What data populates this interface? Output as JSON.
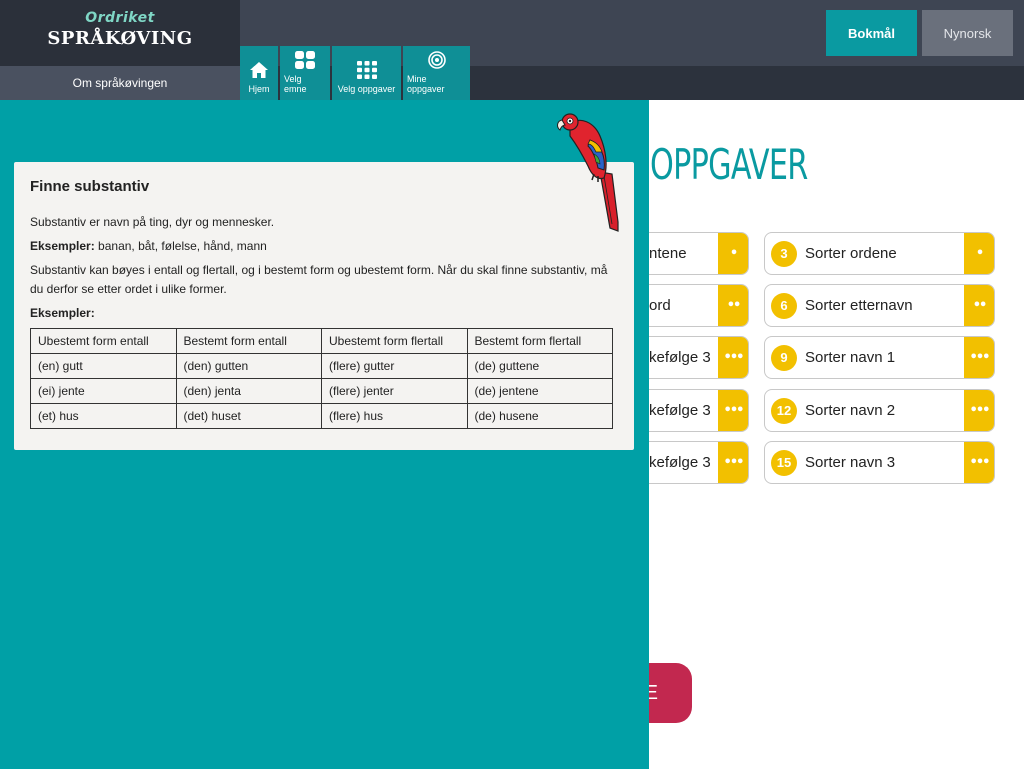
{
  "brand": {
    "logo_top": "Ordriket",
    "logo_main": "SPRÅKØVING"
  },
  "about_link": "Om språkøvingen",
  "nav": [
    {
      "label": "Hjem",
      "icon": "home-icon"
    },
    {
      "label": "Velg emne",
      "icon": "grid-four-icon"
    },
    {
      "label": "Velg oppgaver",
      "icon": "grid-nine-icon"
    },
    {
      "label": "Mine oppgaver",
      "icon": "target-icon"
    }
  ],
  "languages": {
    "bokmal": "Bokmål",
    "nynorsk": "Nynorsk"
  },
  "main": {
    "heading": "OPPGAVER",
    "left_tasks": [
      {
        "label": "ntene",
        "dots": "•"
      },
      {
        "label": "ord",
        "dots": "••"
      },
      {
        "label": "kefølge 3",
        "dots": "•••"
      },
      {
        "label": "kefølge 3",
        "dots": "•••"
      },
      {
        "label": "kefølge 3",
        "dots": "•••"
      }
    ],
    "right_tasks": [
      {
        "num": "3",
        "label": "Sorter ordene",
        "dots": "•"
      },
      {
        "num": "6",
        "label": "Sorter etternavn",
        "dots": "••"
      },
      {
        "num": "9",
        "label": "Sorter navn 1",
        "dots": "•••"
      },
      {
        "num": "12",
        "label": "Sorter navn 2",
        "dots": "•••"
      },
      {
        "num": "15",
        "label": "Sorter navn 3",
        "dots": "•••"
      }
    ],
    "start_button": "E"
  },
  "info": {
    "title": "Finne substantiv",
    "intro": "Substantiv er navn på ting, dyr og mennesker.",
    "examples_label": "Eksempler:",
    "examples": "banan, båt, følelse, hånd, mann",
    "paragraph": "Substantiv kan bøyes i entall og flertall, og i bestemt form og ubestemt form. Når du skal finne substantiv, må du derfor se etter ordet i ulike former.",
    "table_examples_label": "Eksempler:",
    "table": {
      "headers": [
        "Ubestemt form entall",
        "Bestemt form entall",
        "Ubestemt form flertall",
        "Bestemt form flertall"
      ],
      "rows": [
        [
          "(en) gutt",
          "(den) gutten",
          "(flere) gutter",
          "(de) guttene"
        ],
        [
          "(ei) jente",
          "(den) jenta",
          "(flere) jenter",
          "(de) jentene"
        ],
        [
          "(et) hus",
          "(det) huset",
          "(flere) hus",
          "(de) husene"
        ]
      ]
    }
  },
  "colors": {
    "teal": "#00a0a6",
    "header": "#3e4553",
    "yellow": "#f2c000",
    "start": "#c2284f"
  }
}
